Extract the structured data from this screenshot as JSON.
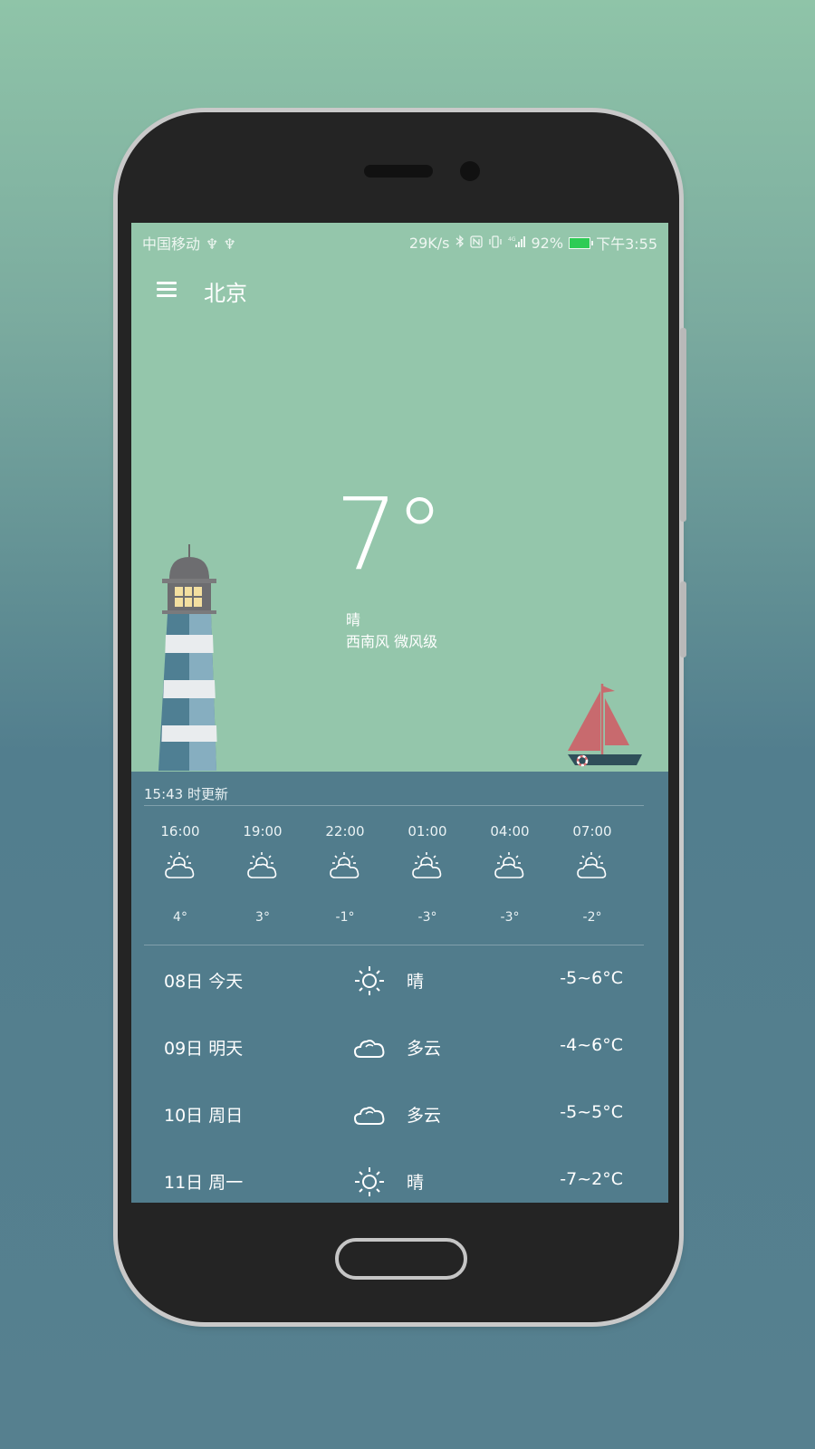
{
  "status_bar": {
    "carrier": "中国移动",
    "usb_symbols": "♆ ♆",
    "net_speed": "29K/s",
    "icons": [
      "bluetooth-icon",
      "nfc-icon",
      "vibrate-icon",
      "4g-signal-icon"
    ],
    "battery": "92%",
    "battery_color": "#2ecc55",
    "time": "下午3:55"
  },
  "header": {
    "city": "北京"
  },
  "current": {
    "temperature": "7°",
    "condition": "晴",
    "wind": "西南风 微风级"
  },
  "updated_text": "15:43 时更新",
  "hourly": [
    {
      "time": "16:00",
      "icon": "partly-cloudy-icon",
      "temp": "4°"
    },
    {
      "time": "19:00",
      "icon": "partly-cloudy-icon",
      "temp": "3°"
    },
    {
      "time": "22:00",
      "icon": "partly-cloudy-icon",
      "temp": "-1°"
    },
    {
      "time": "01:00",
      "icon": "partly-cloudy-icon",
      "temp": "-3°"
    },
    {
      "time": "04:00",
      "icon": "partly-cloudy-icon",
      "temp": "-3°"
    },
    {
      "time": "07:00",
      "icon": "partly-cloudy-icon",
      "temp": "-2°"
    }
  ],
  "daily": [
    {
      "date": "08日  今天",
      "icon": "sun-icon",
      "condition": "晴",
      "range": "-5~6°C"
    },
    {
      "date": "09日  明天",
      "icon": "cloud-icon",
      "condition": "多云",
      "range": "-4~6°C"
    },
    {
      "date": "10日  周日",
      "icon": "cloud-icon",
      "condition": "多云",
      "range": "-5~5°C"
    },
    {
      "date": "11日  周一",
      "icon": "sun-icon",
      "condition": "晴",
      "range": "-7~2°C"
    }
  ],
  "colors": {
    "sky": "#94c6ab",
    "sea": "#517c8c",
    "boat_sail": "#c86a6e"
  }
}
